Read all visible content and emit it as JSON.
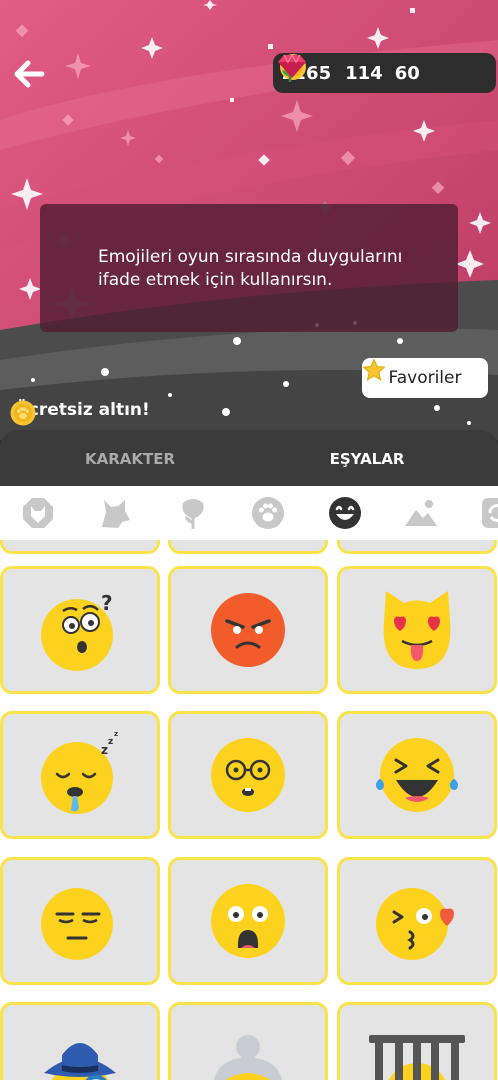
{
  "header": {
    "back_icon": "arrow-left-icon",
    "currency": {
      "gold": "1265",
      "roses": "114",
      "gems": "60"
    },
    "colors": {
      "hero": "#c9426d",
      "accent": "#f9e24a",
      "dark": "#2d2d2d"
    }
  },
  "tooltip": {
    "text": "Emojileri oyun sırasında duygularını ifade etmek için kullanırsın."
  },
  "favorites_button": {
    "label": "Favoriler",
    "icon": "star-icon"
  },
  "free_gold": {
    "label": "Ücretsiz altın!",
    "icon": "paw-coin-icon"
  },
  "tabs": [
    {
      "label": "KARAKTER",
      "active": false
    },
    {
      "label": "EŞYALAR",
      "active": true
    }
  ],
  "categories": [
    {
      "icon": "octagon-wolf-icon",
      "active": false
    },
    {
      "icon": "wolf-icon",
      "active": false
    },
    {
      "icon": "rose-icon",
      "active": false
    },
    {
      "icon": "paw-icon",
      "active": false
    },
    {
      "icon": "emoji-icon",
      "active": true
    },
    {
      "icon": "landscape-icon",
      "active": false
    },
    {
      "icon": "refresh-icon",
      "active": false
    }
  ],
  "emojis": [
    {
      "icon": "confused-emoji-icon"
    },
    {
      "icon": "angry-emoji-icon"
    },
    {
      "icon": "heart-eyes-cat-emoji-icon"
    },
    {
      "icon": "sleeping-emoji-icon"
    },
    {
      "icon": "nerd-glasses-emoji-icon"
    },
    {
      "icon": "laughing-tears-emoji-icon"
    },
    {
      "icon": "unamused-emoji-icon"
    },
    {
      "icon": "shocked-emoji-icon"
    },
    {
      "icon": "kiss-wink-emoji-icon"
    },
    {
      "icon": "detective-emoji-icon"
    },
    {
      "icon": "grandma-emoji-icon"
    },
    {
      "icon": "jailed-emoji-icon"
    }
  ]
}
